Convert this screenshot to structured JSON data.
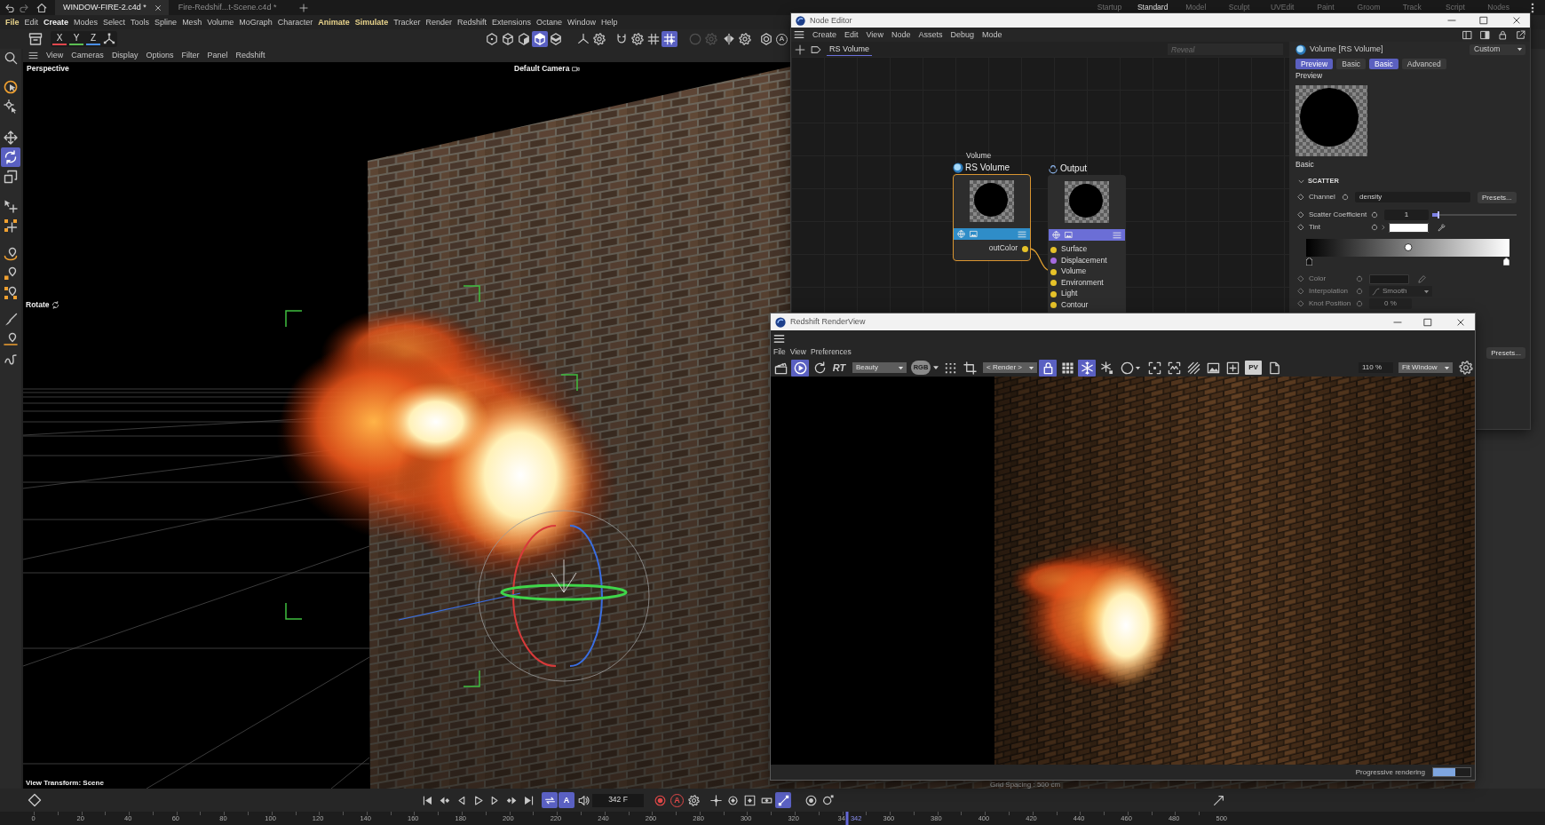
{
  "title_bar": {
    "tabs": [
      {
        "label": "WINDOW-FIRE-2.c4d *",
        "selected": true
      },
      {
        "label": "Fire-Redshif...t-Scene.c4d *",
        "selected": false
      }
    ],
    "layouts": [
      {
        "label": "Startup",
        "selected": false
      },
      {
        "label": "Standard",
        "selected": true
      },
      {
        "label": "Model",
        "selected": false
      },
      {
        "label": "Sculpt",
        "selected": false
      },
      {
        "label": "UVEdit",
        "selected": false
      },
      {
        "label": "Paint",
        "selected": false
      },
      {
        "label": "Groom",
        "selected": false
      },
      {
        "label": "Track",
        "selected": false
      },
      {
        "label": "Script",
        "selected": false
      },
      {
        "label": "Nodes",
        "selected": false
      }
    ]
  },
  "menu_bar": [
    {
      "label": "File",
      "kind": "accent"
    },
    {
      "label": "Edit",
      "kind": "plain"
    },
    {
      "label": "Create",
      "kind": "bold"
    },
    {
      "label": "Modes",
      "kind": "plain"
    },
    {
      "label": "Select",
      "kind": "plain"
    },
    {
      "label": "Tools",
      "kind": "plain"
    },
    {
      "label": "Spline",
      "kind": "plain"
    },
    {
      "label": "Mesh",
      "kind": "plain"
    },
    {
      "label": "Volume",
      "kind": "plain"
    },
    {
      "label": "MoGraph",
      "kind": "plain"
    },
    {
      "label": "Character",
      "kind": "plain"
    },
    {
      "label": "Animate",
      "kind": "accent"
    },
    {
      "label": "Simulate",
      "kind": "accent"
    },
    {
      "label": "Tracker",
      "kind": "plain"
    },
    {
      "label": "Render",
      "kind": "plain"
    },
    {
      "label": "Redshift",
      "kind": "plain"
    },
    {
      "label": "Extensions",
      "kind": "plain"
    },
    {
      "label": "Octane",
      "kind": "plain"
    },
    {
      "label": "Window",
      "kind": "plain"
    },
    {
      "label": "Help",
      "kind": "plain"
    }
  ],
  "toolbar": {
    "axes": [
      {
        "label": "X",
        "color": "#e0474c",
        "on": true
      },
      {
        "label": "Y",
        "color": "#5cbf52",
        "on": true
      },
      {
        "label": "Z",
        "color": "#4a8fe8",
        "on": true
      }
    ],
    "buttons": [
      {
        "on": false,
        "disabled": false
      },
      {
        "on": false,
        "disabled": false
      },
      {
        "on": false,
        "disabled": false
      },
      {
        "on": true,
        "disabled": false
      },
      {
        "on": false,
        "disabled": false
      },
      {
        "on": false,
        "disabled": false
      },
      {
        "on": false,
        "disabled": false
      },
      {
        "on": false,
        "disabled": false
      },
      {
        "on": false,
        "disabled": false
      },
      {
        "on": false,
        "disabled": false
      },
      {
        "on": true,
        "disabled": false
      },
      {
        "on": false,
        "disabled": true
      },
      {
        "on": false,
        "disabled": true
      },
      {
        "on": false,
        "disabled": false
      },
      {
        "on": false,
        "disabled": false
      },
      {
        "on": false,
        "disabled": false
      }
    ],
    "badge": "A"
  },
  "left_toolbar": {
    "tools": [
      {
        "selected": false
      },
      {
        "selected": false
      },
      {
        "selected": false
      },
      {
        "selected": true
      },
      {
        "selected": false
      },
      {
        "selected": false
      },
      {
        "selected": false
      },
      {
        "selected": false
      },
      {
        "selected": false
      },
      {
        "selected": false
      },
      {
        "selected": false
      },
      {
        "selected": false
      },
      {
        "selected": false
      }
    ]
  },
  "viewport": {
    "menu": [
      "View",
      "Cameras",
      "Display",
      "Options",
      "Filter",
      "Panel",
      "Redshift"
    ],
    "view_name": "Perspective",
    "camera": "Default Camera",
    "tool": "Rotate",
    "view_transform": "View Transform: Scene",
    "grid_spacing": "Grid Spacing : 500 cm"
  },
  "node_editor": {
    "title": "Node Editor",
    "menu": [
      "Create",
      "Edit",
      "View",
      "Node",
      "Assets",
      "Debug",
      "Mode"
    ],
    "tab": {
      "label": "RS Volume",
      "selected": true
    },
    "search": {
      "placeholder": "Reveal"
    },
    "nodes": [
      {
        "category": "Volume",
        "title": "RS Volume",
        "selected": true,
        "color": "#2f8dc8",
        "ports": [
          {
            "label": "outColor",
            "kind": "output",
            "color": "#e6c229"
          }
        ]
      },
      {
        "title": "Output",
        "selected": false,
        "color": "#6b6ed6",
        "ports": [
          {
            "label": "Surface",
            "kind": "input",
            "color": "#e6c229"
          },
          {
            "label": "Displacement",
            "kind": "input",
            "color": "#a66be0"
          },
          {
            "label": "Volume",
            "kind": "input",
            "color": "#e6c229"
          },
          {
            "label": "Environment",
            "kind": "input",
            "color": "#e6c229"
          },
          {
            "label": "Light",
            "kind": "input",
            "color": "#e6c229"
          },
          {
            "label": "Contour",
            "kind": "input",
            "color": "#e6c229"
          }
        ]
      }
    ],
    "attributes": {
      "title": "Volume [RS Volume]",
      "preset": "Custom",
      "tabs": [
        {
          "label": "Preview",
          "selected": true
        },
        {
          "label": "Basic",
          "selected": false
        },
        {
          "label": "Basic",
          "selected": true
        },
        {
          "label": "Advanced",
          "selected": false
        }
      ],
      "preview_label": "Preview",
      "group_label": "Basic",
      "section": {
        "title": "SCATTER",
        "expanded": true
      },
      "rows": [
        {
          "kind": "text",
          "label": "Channel",
          "value": "density",
          "button": "Presets...",
          "disabled": false
        },
        {
          "kind": "slider",
          "label": "Scatter Coefficient",
          "value": "1",
          "level": 0.08,
          "disabled": false
        },
        {
          "kind": "color",
          "label": "Tint",
          "color": "#ffffff",
          "disabled": false
        },
        {
          "kind": "gradient",
          "level": 0.5
        },
        {
          "kind": "color",
          "label": "Color",
          "color": "#1a1a1a",
          "disabled": true
        },
        {
          "kind": "dropdown",
          "label": "Interpolation",
          "value": "Smooth",
          "disabled": true
        },
        {
          "kind": "number",
          "label": "Knot Position",
          "value": "0 %",
          "disabled": true
        },
        {
          "kind": "presets",
          "button": "Presets..."
        }
      ]
    }
  },
  "render_view": {
    "title": "Redshift RenderView",
    "menu": [
      "File",
      "View",
      "Preferences"
    ],
    "toolbar": {
      "start": [
        {
          "on": false
        },
        {
          "on": true
        },
        {
          "on": false
        }
      ],
      "rt": "RT",
      "aov": "Beauty",
      "channels": "RGB",
      "mid": [
        {
          "on": false
        },
        {
          "on": false
        }
      ],
      "camera": "< Render >",
      "view": [
        {
          "on": true
        },
        {
          "on": false
        },
        {
          "on": true
        },
        {
          "on": false
        },
        {
          "on": false
        },
        {
          "on": false
        },
        {
          "on": false
        },
        {
          "on": false
        },
        {
          "on": false
        },
        {
          "on": false
        }
      ],
      "pv": "PV",
      "end": [
        {
          "on": false
        }
      ],
      "zoom": "110 %",
      "fit": "Fit Window"
    },
    "status": {
      "text": "Progressive rendering",
      "level": 0.6
    }
  },
  "timeline": {
    "controls": [
      {
        "on": false
      },
      {
        "on": false
      },
      {
        "on": false
      },
      {
        "on": false
      },
      {
        "on": false
      },
      {
        "on": false
      },
      {
        "on": false
      },
      {
        "on": true
      },
      {
        "on": true,
        "label": "A"
      },
      {
        "on": false
      },
      {
        "on": false
      },
      {
        "on": false,
        "label": "A"
      },
      {
        "on": false
      },
      {
        "on": false
      },
      {
        "on": false
      },
      {
        "on": false
      },
      {
        "on": false
      },
      {
        "on": true
      },
      {
        "on": false
      },
      {
        "on": false
      },
      {
        "on": false
      }
    ],
    "frame": "342 F",
    "ruler": {
      "labels": [
        "0",
        "20",
        "40",
        "60",
        "80",
        "100",
        "120",
        "140",
        "160",
        "180",
        "200",
        "220",
        "240",
        "260",
        "280",
        "300",
        "320",
        "34",
        "360",
        "380",
        "400",
        "420",
        "440",
        "460",
        "480",
        "500"
      ],
      "current": {
        "label": "342",
        "level": 0.684
      }
    }
  }
}
